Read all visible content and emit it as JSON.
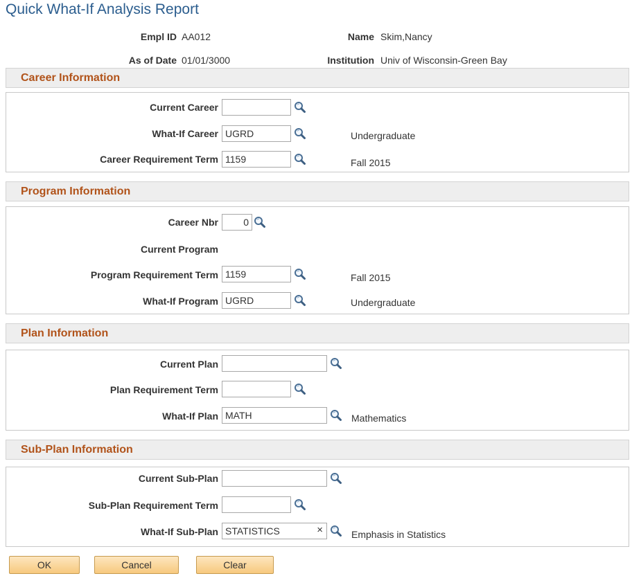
{
  "page": {
    "title": "Quick What-If Analysis Report"
  },
  "header": {
    "empl_id_label": "Empl ID",
    "empl_id": "AA012",
    "name_label": "Name",
    "name": "Skim,Nancy",
    "as_of_date_label": "As of Date",
    "as_of_date": "01/01/3000",
    "institution_label": "Institution",
    "institution": "Univ of Wisconsin-Green Bay"
  },
  "career": {
    "title": "Career Information",
    "current_career_label": "Current Career",
    "current_career": "",
    "whatif_career_label": "What-If Career",
    "whatif_career": "UGRD",
    "whatif_career_desc": "Undergraduate",
    "req_term_label": "Career Requirement Term",
    "req_term": "1159",
    "req_term_desc": "Fall 2015"
  },
  "program": {
    "title": "Program Information",
    "career_nbr_label": "Career Nbr",
    "career_nbr": "0",
    "current_program_label": "Current Program",
    "req_term_label": "Program Requirement Term",
    "req_term": "1159",
    "req_term_desc": "Fall 2015",
    "whatif_program_label": "What-If Program",
    "whatif_program": "UGRD",
    "whatif_program_desc": "Undergraduate"
  },
  "plan": {
    "title": "Plan Information",
    "current_plan_label": "Current Plan",
    "current_plan": "",
    "req_term_label": "Plan Requirement Term",
    "req_term": "",
    "whatif_plan_label": "What-If Plan",
    "whatif_plan": "MATH",
    "whatif_plan_desc": "Mathematics"
  },
  "subplan": {
    "title": "Sub-Plan Information",
    "current_subplan_label": "Current Sub-Plan",
    "current_subplan": "",
    "req_term_label": "Sub-Plan Requirement Term",
    "req_term": "",
    "whatif_subplan_label": "What-If Sub-Plan",
    "whatif_subplan": "STATISTICS",
    "clear_glyph": "×",
    "whatif_subplan_desc": "Emphasis in Statistics"
  },
  "buttons": {
    "ok": "OK",
    "cancel": "Cancel",
    "clear": "Clear"
  },
  "icons": {
    "lookup": "magnifier-lookup-icon"
  }
}
